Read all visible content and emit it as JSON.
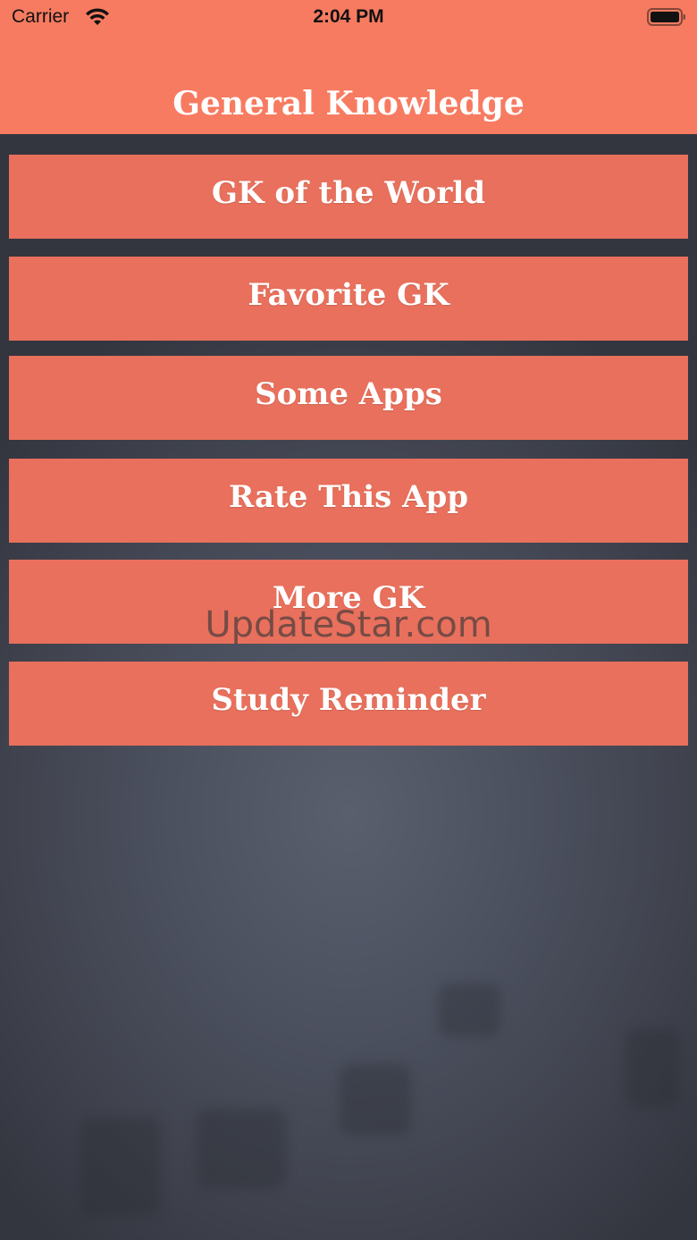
{
  "status_bar": {
    "carrier": "Carrier",
    "time": "2:04 PM",
    "wifi_icon": "wifi-icon",
    "battery_icon": "battery-icon"
  },
  "header": {
    "title": "General Knowledge",
    "background_color": "#f77b61"
  },
  "menu": {
    "button_color": "#e8705c",
    "items": [
      {
        "label": "GK of the World"
      },
      {
        "label": "Favorite GK"
      },
      {
        "label": "Some Apps"
      },
      {
        "label": "Rate This App"
      },
      {
        "label": "More GK"
      },
      {
        "label": "Study Reminder"
      }
    ]
  },
  "watermark": "UpdateStar.com"
}
